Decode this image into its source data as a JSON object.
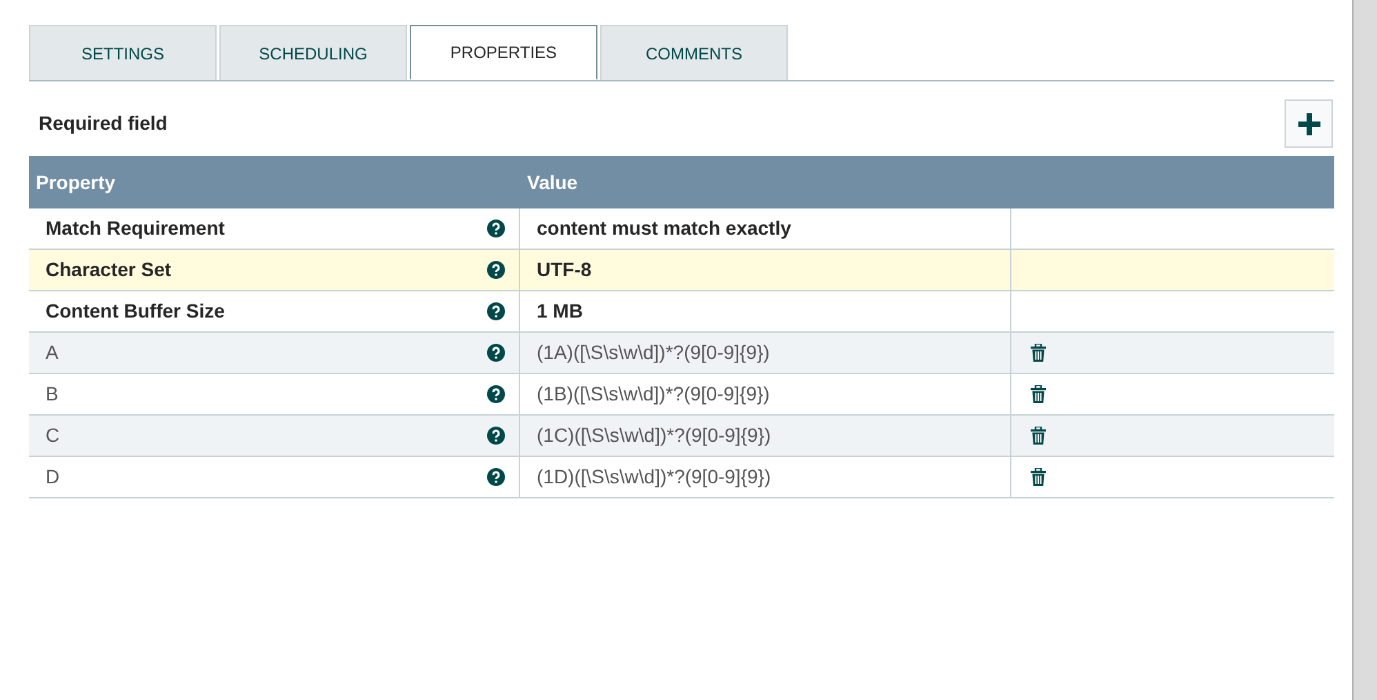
{
  "tabs": [
    {
      "label": "SETTINGS",
      "selected": false
    },
    {
      "label": "SCHEDULING",
      "selected": false
    },
    {
      "label": "PROPERTIES",
      "selected": true
    },
    {
      "label": "COMMENTS",
      "selected": false
    }
  ],
  "required_label": "Required field",
  "table": {
    "columns": [
      "Property",
      "Value"
    ],
    "rows": [
      {
        "property": "Match Requirement",
        "value": "content must match exactly",
        "required": true,
        "selected": false,
        "deletable": false
      },
      {
        "property": "Character Set",
        "value": "UTF-8",
        "required": true,
        "selected": true,
        "deletable": false
      },
      {
        "property": "Content Buffer Size",
        "value": "1 MB",
        "required": true,
        "selected": false,
        "deletable": false
      },
      {
        "property": "A",
        "value": "(1A)([\\S\\s\\w\\d])*?(9[0-9]{9})",
        "required": false,
        "selected": false,
        "deletable": true
      },
      {
        "property": "B",
        "value": "(1B)([\\S\\s\\w\\d])*?(9[0-9]{9})",
        "required": false,
        "selected": false,
        "deletable": true
      },
      {
        "property": "C",
        "value": "(1C)([\\S\\s\\w\\d])*?(9[0-9]{9})",
        "required": false,
        "selected": false,
        "deletable": true
      },
      {
        "property": "D",
        "value": "(1D)([\\S\\s\\w\\d])*?(9[0-9]{9})",
        "required": false,
        "selected": false,
        "deletable": true
      }
    ]
  }
}
